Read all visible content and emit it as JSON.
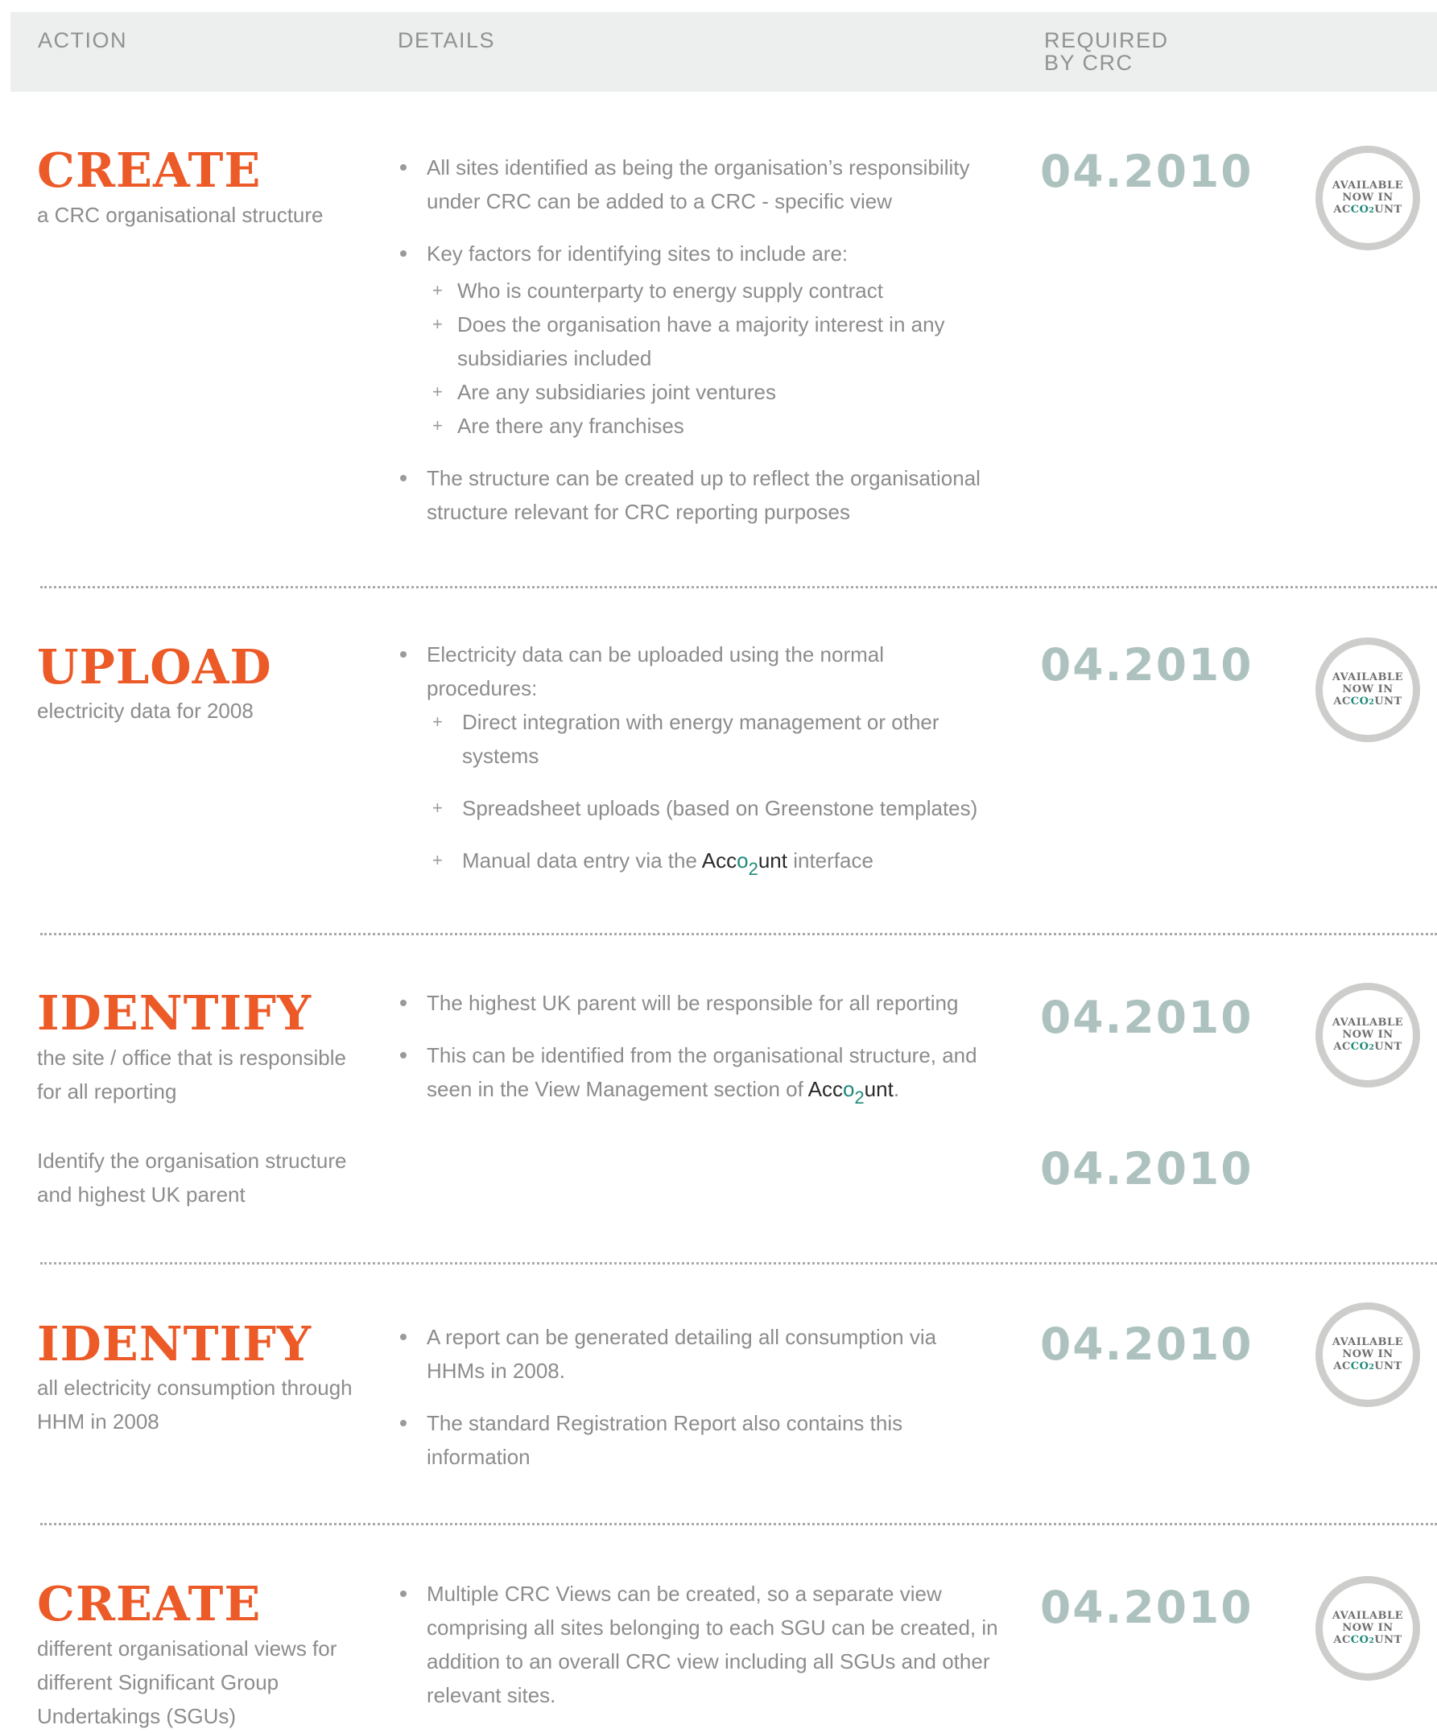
{
  "header": {
    "action": "ACTION",
    "details": "DETAILS",
    "required_line1": "REQUIRED",
    "required_line2": "BY CRC"
  },
  "badge": {
    "line1": "AVAILABLE",
    "line2": "NOW IN",
    "brand_prefix": "AC",
    "brand_co": "CO",
    "brand_sub": "2",
    "brand_suffix": "UNT"
  },
  "brand": {
    "prefix": "Acc",
    "co": "o",
    "sub": "2",
    "suffix": "unt"
  },
  "sections": [
    {
      "verb": "CREATE",
      "sub": "a CRC organisational structure",
      "date": "04.2010",
      "bullets": [
        "All sites identified as being the organisation’s responsibility under CRC can be added to a CRC - specific view",
        "Key factors for identifying sites to include are:",
        "The structure can be created up to reflect the organisational structure relevant for CRC reporting purposes"
      ],
      "subitems": [
        "Who is counterparty to energy supply contract",
        "Does the organisation have a majority interest in any subsidiaries included",
        "Are any subsidiaries joint ventures",
        "Are there any franchises"
      ]
    },
    {
      "verb": "UPLOAD",
      "sub": "electricity data for 2008",
      "date": "04.2010",
      "bullets": [
        "Electricity data can be uploaded using the normal procedures:"
      ],
      "subitems": [
        "Direct integration with energy management or other systems",
        "Spreadsheet uploads (based on Greenstone templates)",
        "Manual data entry via the",
        "interface"
      ]
    },
    {
      "verb": "IDENTIFY",
      "sub": "the site / office that is responsible for all reporting",
      "sub2": "Identify the organisation structure and highest UK parent",
      "date": "04.2010",
      "date2": "04.2010",
      "bullets": [
        "The highest UK parent will be responsible for all reporting",
        "This can be identified from the organisational structure, and seen in the View Management section of",
        "."
      ]
    },
    {
      "verb": "IDENTIFY",
      "sub": "all electricity consumption through HHM in 2008",
      "date": "04.2010",
      "bullets": [
        "A report can be generated detailing all consumption via HHMs in 2008.",
        "The standard Registration Report also contains this information"
      ]
    },
    {
      "verb": "CREATE",
      "sub": "different organisational views for different Significant Group Undertakings (SGUs)",
      "date": "04.2010",
      "bullets": [
        "Multiple CRC Views can be created, so a separate view comprising all sites belonging to each SGU can be created, in addition to an overall CRC view including all SGUs and other relevant sites."
      ]
    }
  ]
}
